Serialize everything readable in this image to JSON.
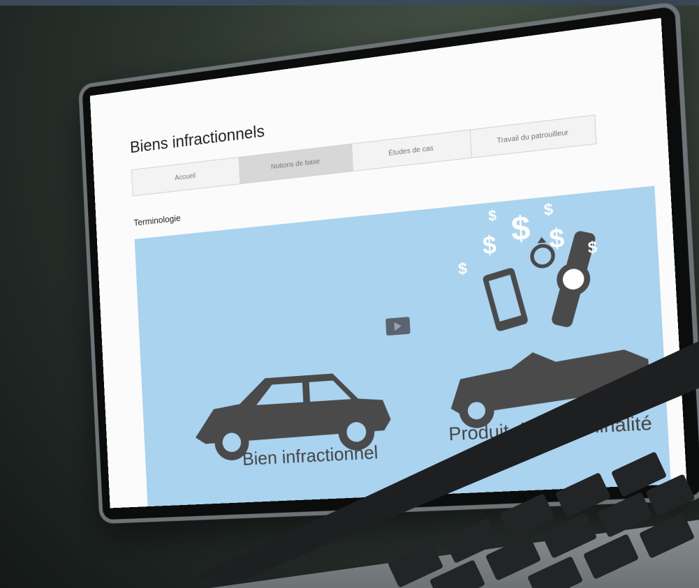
{
  "page": {
    "title": "Biens infractionnels",
    "tabs": [
      {
        "label": "Accueil",
        "active": false
      },
      {
        "label": "Notions de base",
        "active": true
      },
      {
        "label": "Études de cas",
        "active": false
      },
      {
        "label": "Travail du patrouilleur",
        "active": false
      }
    ],
    "section_title": "Terminologie",
    "illustration": {
      "left_caption": "Bien infractionnel",
      "right_caption": "Produit de la criminalité",
      "dollar_glyph": "$",
      "background_color": "#a9d3ef",
      "icon_color": "#4a4a4a"
    }
  },
  "icons": [
    "sedan-car-icon",
    "convertible-car-icon",
    "smartphone-icon",
    "ring-icon",
    "watch-icon",
    "dollar-sign-icon",
    "play-icon"
  ]
}
